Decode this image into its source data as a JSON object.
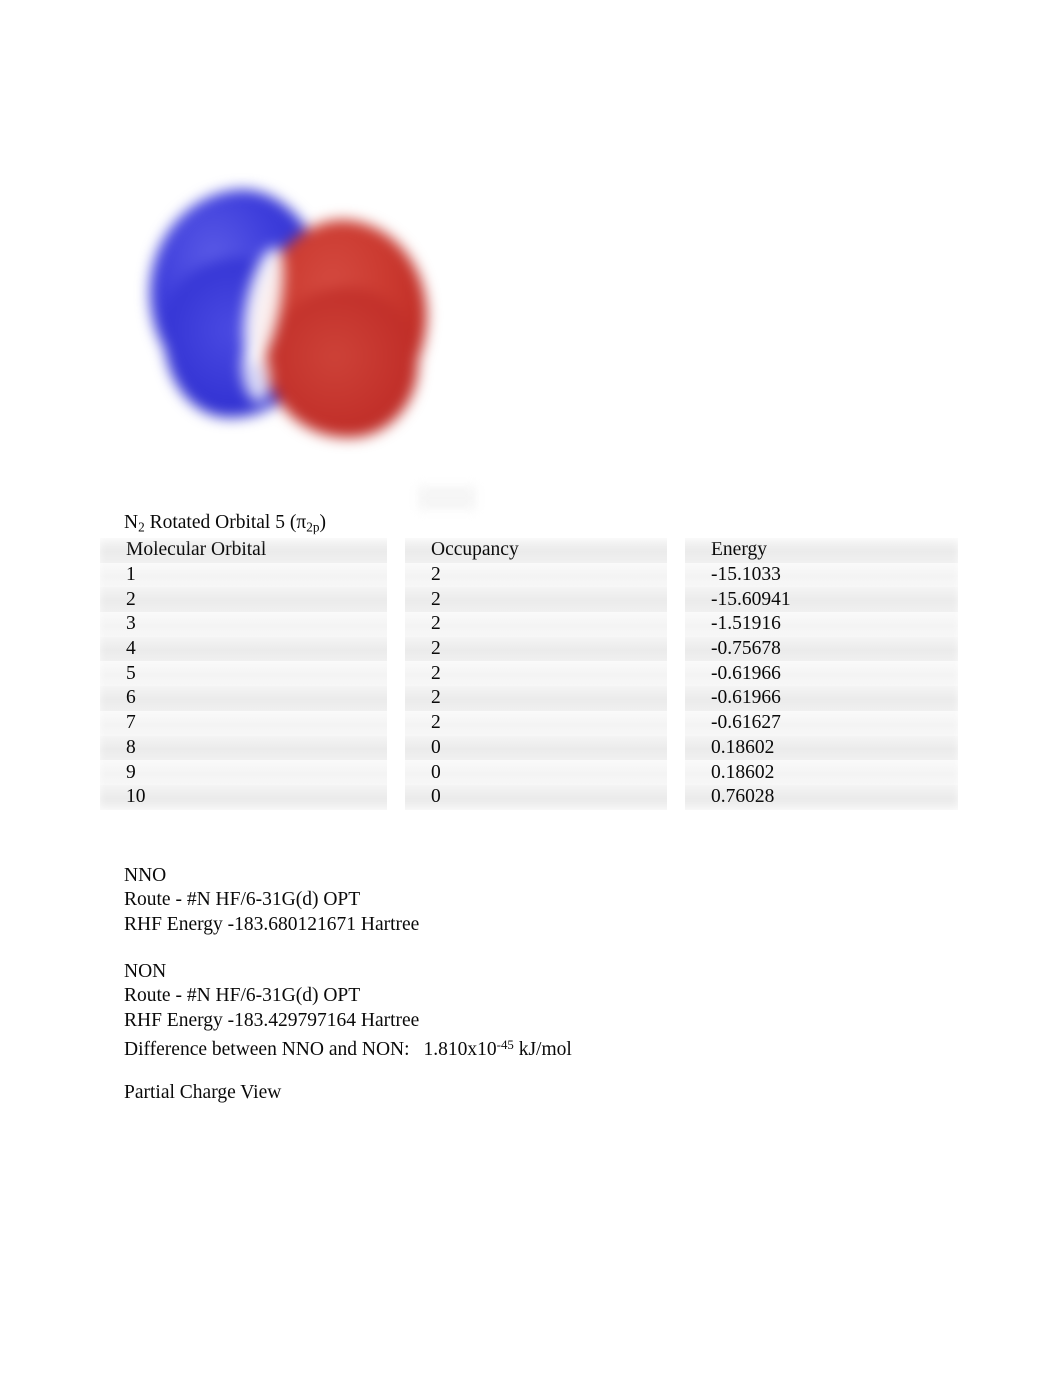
{
  "figure": {
    "name": "molecular-orbital-isosurface",
    "description": "Two-lobe pi molecular orbital isosurface rendering",
    "colors": {
      "positive_lobe": "#3434d4",
      "negative_lobe": "#c2302a"
    }
  },
  "caption": {
    "prefix": "N",
    "sub_molecule": "2",
    "middle": " Rotated Orbital 5 (",
    "greek": "π",
    "sub_orbital": "2p",
    "suffix": ")"
  },
  "table": {
    "headers": [
      "Molecular Orbital",
      "Occupancy",
      "Energy"
    ],
    "rows": [
      {
        "orbital": "1",
        "occupancy": "2",
        "energy": "-15.1033"
      },
      {
        "orbital": "2",
        "occupancy": "2",
        "energy": "-15.60941"
      },
      {
        "orbital": "3",
        "occupancy": "2",
        "energy": "-1.51916"
      },
      {
        "orbital": "4",
        "occupancy": "2",
        "energy": "-0.75678"
      },
      {
        "orbital": "5",
        "occupancy": "2",
        "energy": "-0.61966"
      },
      {
        "orbital": "6",
        "occupancy": "2",
        "energy": "-0.61966"
      },
      {
        "orbital": "7",
        "occupancy": "2",
        "energy": "-0.61627"
      },
      {
        "orbital": "8",
        "occupancy": "0",
        "energy": "0.18602"
      },
      {
        "orbital": "9",
        "occupancy": "0",
        "energy": "0.18602"
      },
      {
        "orbital": "10",
        "occupancy": "0",
        "energy": "0.76028"
      }
    ]
  },
  "nno": {
    "title": "NNO",
    "route": "Route - #N HF/6-31G(d) OPT",
    "energy": "RHF Energy -183.680121671 Hartree"
  },
  "non": {
    "title": "NON",
    "route": "Route - #N HF/6-31G(d) OPT",
    "energy": "RHF Energy -183.429797164 Hartree",
    "difference_label": "Difference between NNO and NON:",
    "difference_value": "1.810x10",
    "difference_exponent": "-45",
    "difference_unit": " kJ/mol"
  },
  "partial_charge": {
    "heading": "Partial Charge View"
  }
}
